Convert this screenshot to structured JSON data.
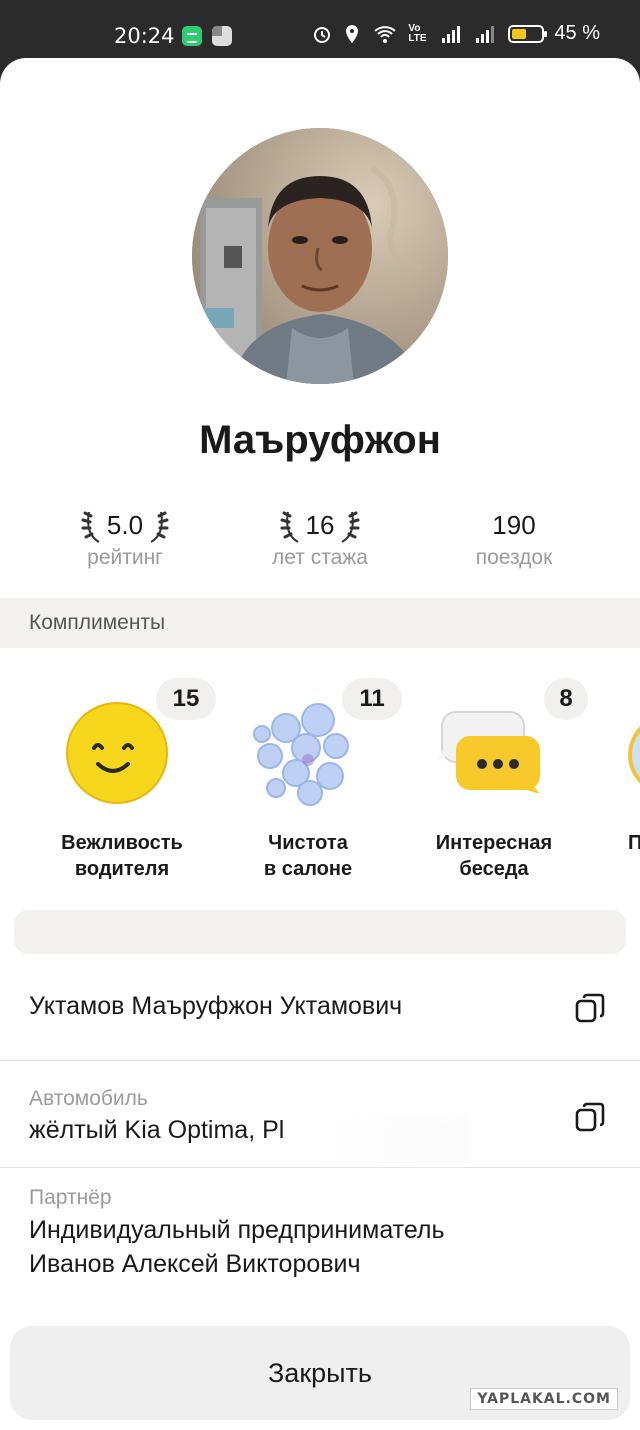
{
  "status_bar": {
    "time": "20:24",
    "battery": "45 %",
    "lte": "Vo LTE"
  },
  "profile": {
    "name": "Маъруфжон"
  },
  "stats": [
    {
      "value": "5.0",
      "label": "рейтинг"
    },
    {
      "value": "16",
      "label": "лет стажа"
    },
    {
      "value": "190",
      "label": "поездок"
    }
  ],
  "compliments": {
    "title": "Комплименты",
    "items": [
      {
        "count": "15",
        "line1": "Вежливость",
        "line2": "водителя",
        "icon": "smiley-face-icon"
      },
      {
        "count": "11",
        "line1": "Чистота",
        "line2": "в салоне",
        "icon": "soap-bubbles-icon"
      },
      {
        "count": "8",
        "line1": "Интересная",
        "line2": "беседа",
        "icon": "chat-bubbles-icon"
      },
      {
        "line1": "П",
        "icon": "partial-compliment-icon"
      }
    ]
  },
  "details": {
    "full_name": "Уктамов Маъруфжон Уктамович",
    "car_caption": "Автомобиль",
    "car_value": "жёлтый Kia Optima, Pl",
    "partner_caption": "Партнёр",
    "partner_line1": "Индивидуальный предприниматель",
    "partner_line2": "Иванов Алексей Викторович"
  },
  "close_button": "Закрыть",
  "watermark": "YAPLAKAL.COM"
}
